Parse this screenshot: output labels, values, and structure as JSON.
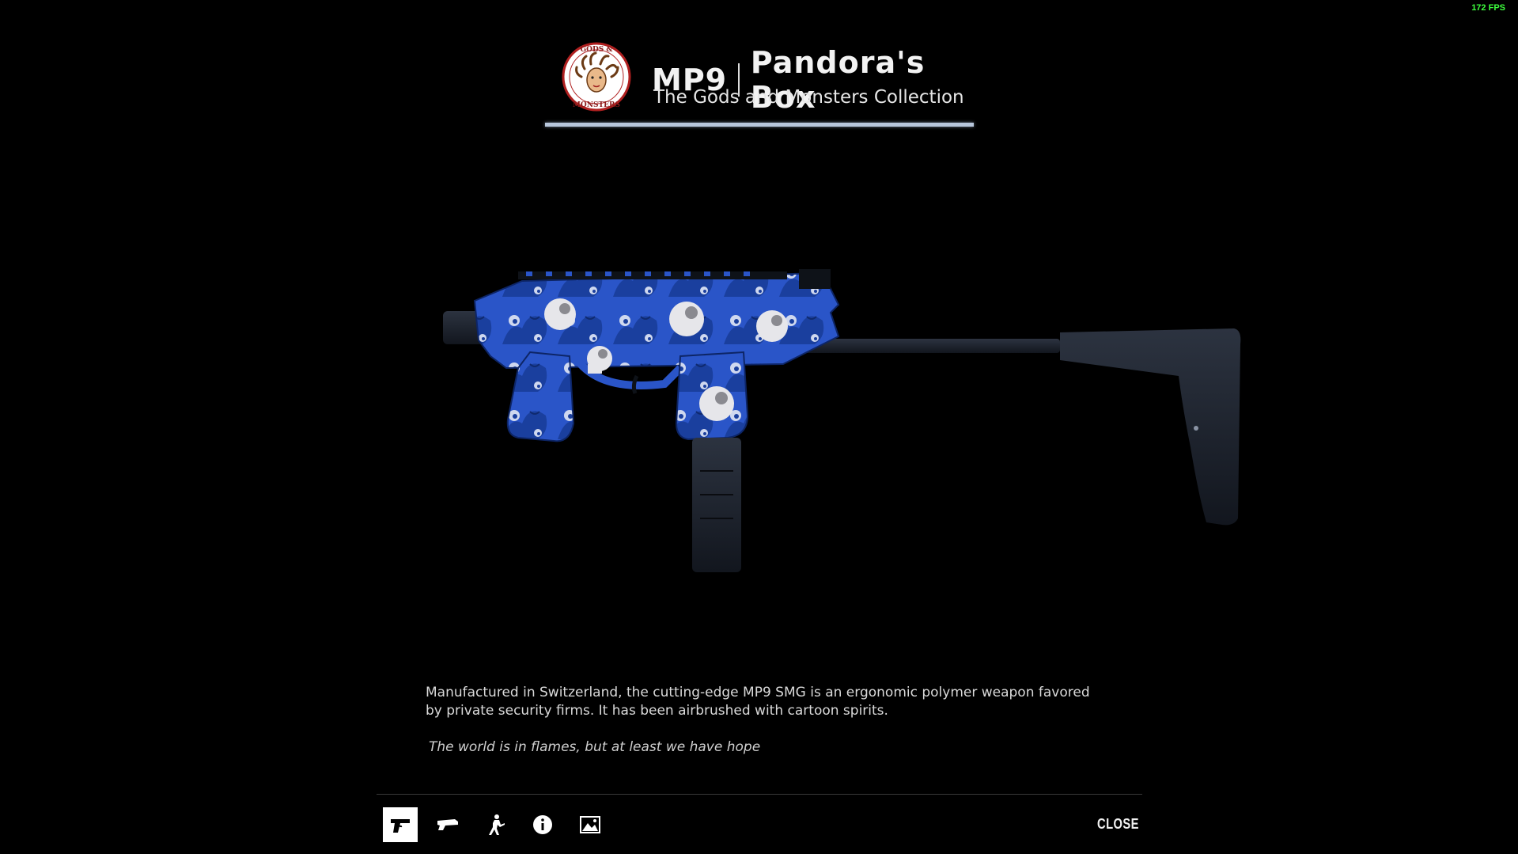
{
  "fps": "172 FPS",
  "item": {
    "weapon": "MP9",
    "skin": "Pandora's Box",
    "collection": "The Gods and Monsters Collection",
    "rarity_color": "#b8c7dc",
    "description": "Manufactured in Switzerland, the cutting-edge MP9 SMG is an ergonomic polymer weapon favored by private security firms. It has been airbrushed with cartoon spirits.",
    "quote": "The world is in flames, but at least we have hope"
  },
  "collection_logo": {
    "icon": "gods-and-monsters-medusa-logo",
    "text": "GODS & MONSTERS"
  },
  "toolbar": {
    "items": [
      {
        "icon": "pistol-icon",
        "active": true
      },
      {
        "icon": "weapon-side-icon",
        "active": false
      },
      {
        "icon": "player-model-icon",
        "active": false
      },
      {
        "icon": "info-icon",
        "active": false
      },
      {
        "icon": "image-icon",
        "active": false
      }
    ],
    "close_label": "CLOSE"
  },
  "colors": {
    "background": "#000000",
    "skin_primary": "#2a55c8",
    "skin_dark": "#143a9a",
    "metal": "#1e2430",
    "fps_text": "#3dff3d"
  }
}
